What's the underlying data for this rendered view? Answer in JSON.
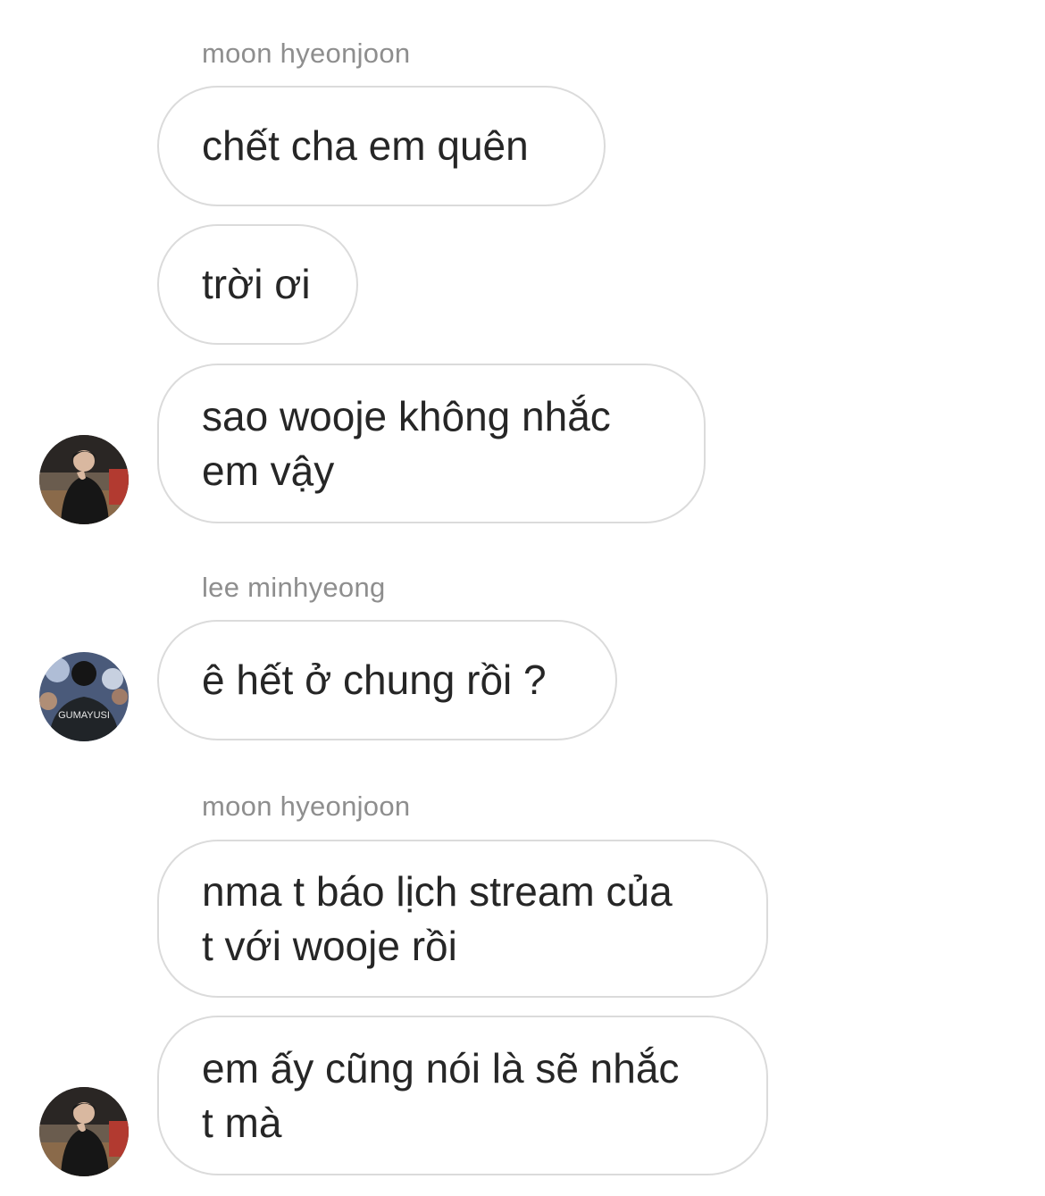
{
  "thread": {
    "groups": [
      {
        "sender": "moon hyeonjoon",
        "messages": [
          "chết cha em quên",
          "trời ơi",
          [
            "sao wooje không nhắc",
            "em vậy"
          ]
        ]
      },
      {
        "sender": "lee minhyeong",
        "messages": [
          "ê hết ở chung rồi ?"
        ]
      },
      {
        "sender": "moon hyeonjoon",
        "messages": [
          [
            "nma t báo lịch stream của",
            "t với wooje rồi"
          ],
          [
            "em ấy cũng nói là sẽ nhắc",
            "t mà"
          ]
        ]
      }
    ]
  },
  "avatars": {
    "moon_hyeonjoon": "profile-photo-person-night",
    "lee_minhyeong": "profile-photo-jersey",
    "jersey_text": "GUMAYUSI"
  },
  "colors": {
    "background": "#ffffff",
    "bubble_border": "#dbdbdb",
    "text": "#262626",
    "sender_name": "#8e8e8e"
  }
}
